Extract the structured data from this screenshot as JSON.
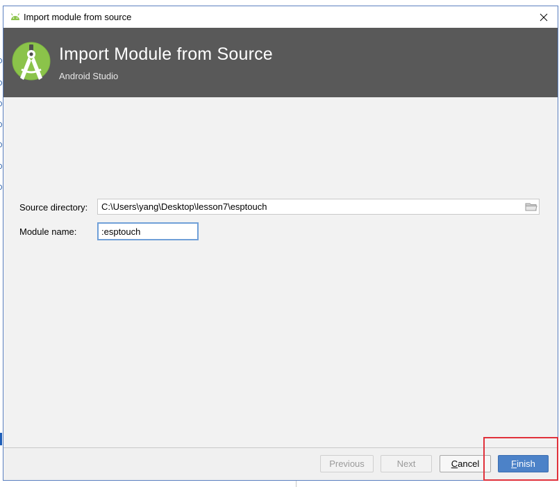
{
  "window": {
    "title": "Import module from source",
    "close_glyph": "✕"
  },
  "header": {
    "title": "Import Module from Source",
    "subtitle": "Android Studio"
  },
  "form": {
    "source_directory_label": "Source directory:",
    "source_directory_value": "C:\\Users\\yang\\Desktop\\lesson7\\esptouch",
    "module_name_label": "Module name:",
    "module_name_value": ":esptouch"
  },
  "buttons": {
    "previous": "Previous",
    "next": "Next",
    "cancel_mnemonic": "C",
    "cancel_rest": "ancel",
    "finish_mnemonic": "F",
    "finish_rest": "inish"
  },
  "colors": {
    "header_bg": "#595959",
    "android_green": "#8bc34a",
    "primary_button": "#4c82c8",
    "highlight": "#e0303a"
  },
  "icons": {
    "titlebar": "android-icon",
    "logo": "android-studio-logo",
    "browse": "folder-icon",
    "close": "close-icon"
  }
}
